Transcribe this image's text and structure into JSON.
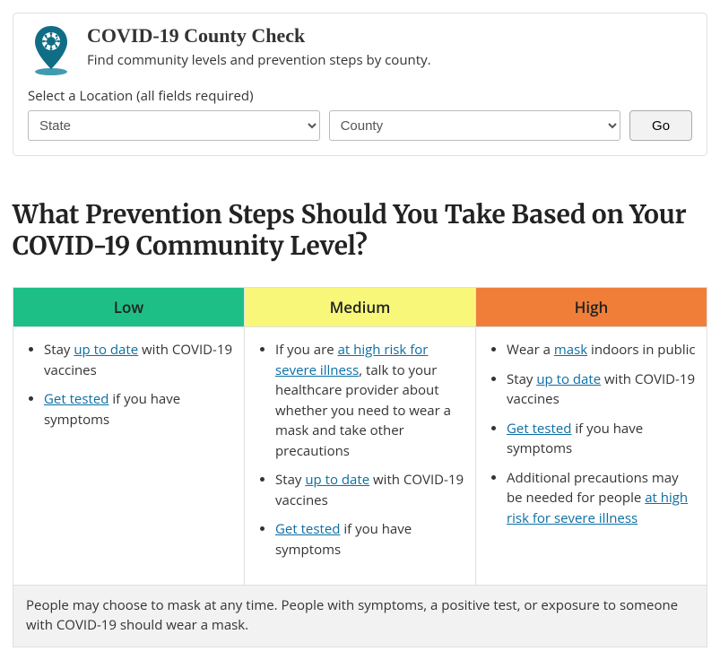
{
  "card": {
    "title": "COVID-19 County Check",
    "subtitle": "Find community levels and prevention steps by county.",
    "select_label": "Select a Location (all fields required)",
    "state_placeholder": "State",
    "county_placeholder": "County",
    "go_label": "Go"
  },
  "heading": "What Prevention Steps Should You Take Based on Your COVID-19 Community Level?",
  "table": {
    "headers": {
      "low": "Low",
      "medium": "Medium",
      "high": "High"
    },
    "low": {
      "item1_pre": "Stay ",
      "item1_link": "up to date",
      "item1_post": " with COVID-19 vaccines",
      "item2_link": "Get tested",
      "item2_post": " if you have symptoms"
    },
    "medium": {
      "item1_pre": "If you are ",
      "item1_link": "at high risk for severe illness",
      "item1_post": ", talk to your healthcare provider about whether you need to wear a mask and take other precautions",
      "item2_pre": "Stay ",
      "item2_link": "up to date",
      "item2_post": " with COVID-19 vaccines",
      "item3_link": "Get tested",
      "item3_post": " if you have symptoms"
    },
    "high": {
      "item1_pre": "Wear a ",
      "item1_link": "mask",
      "item1_post": " indoors in public",
      "item2_pre": "Stay ",
      "item2_link": "up to date",
      "item2_post": " with COVID-19 vaccines",
      "item3_link": "Get tested",
      "item3_post": " if you have symptoms",
      "item4_pre": "Additional precautions may be needed for people ",
      "item4_link": "at high risk for severe illness"
    },
    "footnote": "People may choose to mask at any time. People with symptoms, a positive test, or exposure to someone with COVID-19 should wear a mask."
  }
}
